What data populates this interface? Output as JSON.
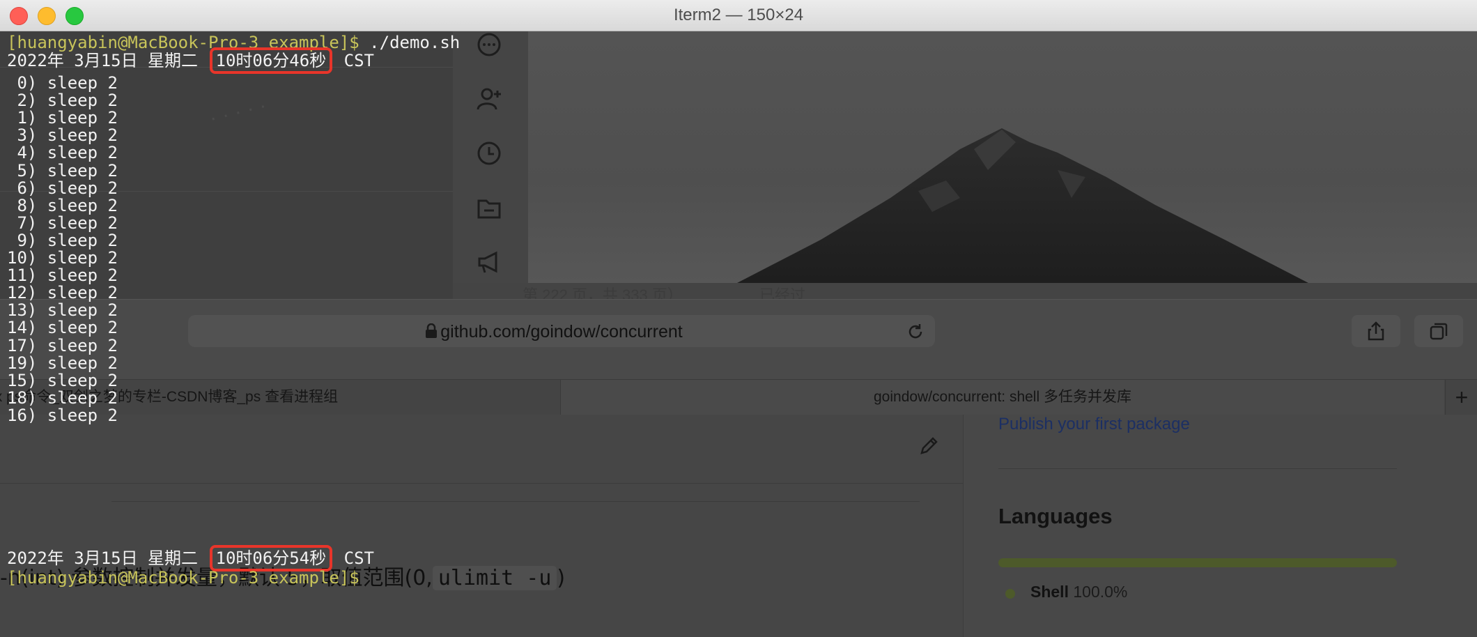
{
  "window": {
    "title": "Iterm2 — 150×24",
    "buttons": [
      "close",
      "minimize",
      "zoom"
    ]
  },
  "terminal": {
    "prompt": "[huangyabin@MacBook-Pro-3 example]$",
    "command": " ./demo.sh",
    "start_date": "2022年 3月15日 星期二 ",
    "start_time": "10时06分46秒",
    "timezone": " CST",
    "jobs": [
      " 0) sleep 2",
      " 2) sleep 2",
      " 1) sleep 2",
      " 3) sleep 2",
      " 4) sleep 2",
      " 5) sleep 2",
      " 6) sleep 2",
      " 8) sleep 2",
      " 7) sleep 2",
      " 9) sleep 2",
      "10) sleep 2",
      "11) sleep 2",
      "12) sleep 2",
      "13) sleep 2",
      "14) sleep 2",
      "17) sleep 2",
      "19) sleep 2",
      "15) sleep 2",
      "18) sleep 2",
      "16) sleep 2"
    ],
    "end_date": "2022年 3月15日 星期二 ",
    "end_time": "10时06分54秒",
    "end_prompt": "[huangyabin@MacBook-Pro-3 example]$",
    "highlight_color": "#e8352a"
  },
  "background": {
    "browser": {
      "url": "github.com/goindow/concurrent",
      "tabs": [
        {
          "label": "linux ps命令_双剑之梦的专栏-CSDN博客_ps 查看进程组"
        },
        {
          "label": "goindow/concurrent: shell 多任务并发库"
        }
      ],
      "new_tab": "+"
    },
    "github": {
      "publish_link": "Publish your first package",
      "languages_title": "Languages",
      "language": "Shell",
      "language_pct": "100.0%",
      "language_share": 1.0,
      "readme_text": "-n(int) 参数控制并发量，默认 5，取值范围(0,",
      "readme_code": "ulimit -u",
      "readme_close": ")"
    },
    "gallery": {
      "caption": "第 222 页，共 333 页）",
      "caption_right": "已经过"
    },
    "rail_icons": [
      "more-icon",
      "add-user-icon",
      "history-icon",
      "folder-icon",
      "megaphone-icon"
    ]
  },
  "colors": {
    "prompt": "#c8c45a",
    "text": "#f2f2f2",
    "link": "#1c2f63",
    "lang_bar": "#4d5a2a"
  }
}
